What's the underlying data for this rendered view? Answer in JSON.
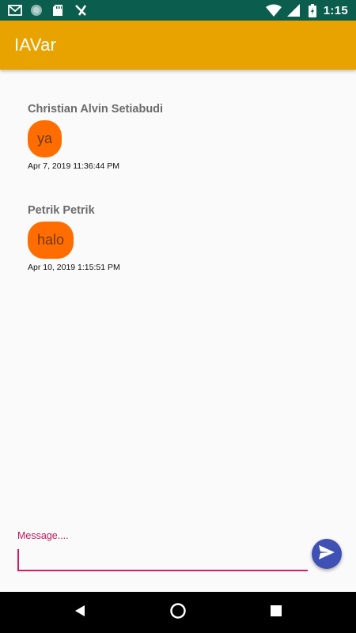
{
  "status_bar": {
    "time": "1:15",
    "left_icons": [
      "gmail-icon",
      "sync-icon",
      "sd-card-icon",
      "download-icon"
    ],
    "right_icons": [
      "wifi-icon",
      "cellular-icon",
      "battery-icon"
    ]
  },
  "app_bar": {
    "title": "IAVar",
    "color": "#e8a300"
  },
  "messages": [
    {
      "sender": "Christian Alvin Setiabudi",
      "text": "ya",
      "time": "Apr 7, 2019 11:36:44 PM"
    },
    {
      "sender": "Petrik Petrik",
      "text": "halo",
      "time": "Apr 10, 2019 1:15:51 PM"
    }
  ],
  "composer": {
    "label": "Message....",
    "value": "",
    "accent": "#d81b60",
    "send_icon": "send-icon",
    "send_color": "#3f51b5"
  },
  "nav_bar": {
    "icons": [
      "back-icon",
      "home-icon",
      "recents-icon"
    ]
  }
}
